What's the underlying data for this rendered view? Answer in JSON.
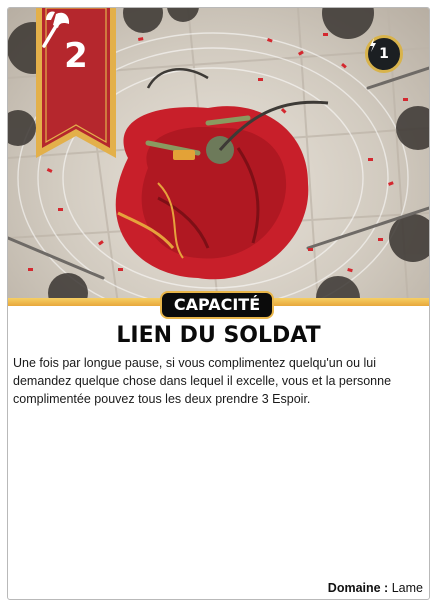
{
  "card": {
    "level": "2",
    "hope_cost": "1",
    "type": "CAPACITÉ",
    "title": "LIEN DU SOLDAT",
    "text": "Une fois par longue pause, si vous complimentez quelqu'un ou lui demandez quelque chose dans lequel il excelle, vous et la personne complimentée pouvez tous les deux prendre 3 Espoir.",
    "domain_label": "Domaine :",
    "domain_value": "Lame"
  },
  "icons": {
    "banner": "axe-icon",
    "hope": "hope-icon"
  },
  "colors": {
    "banner_red": "#b5272d",
    "banner_gold": "#e3b04a",
    "type_pill_bg": "#0b0b0b",
    "gold_bar": "#f2c35a",
    "cloak_red": "#c81f2a"
  }
}
